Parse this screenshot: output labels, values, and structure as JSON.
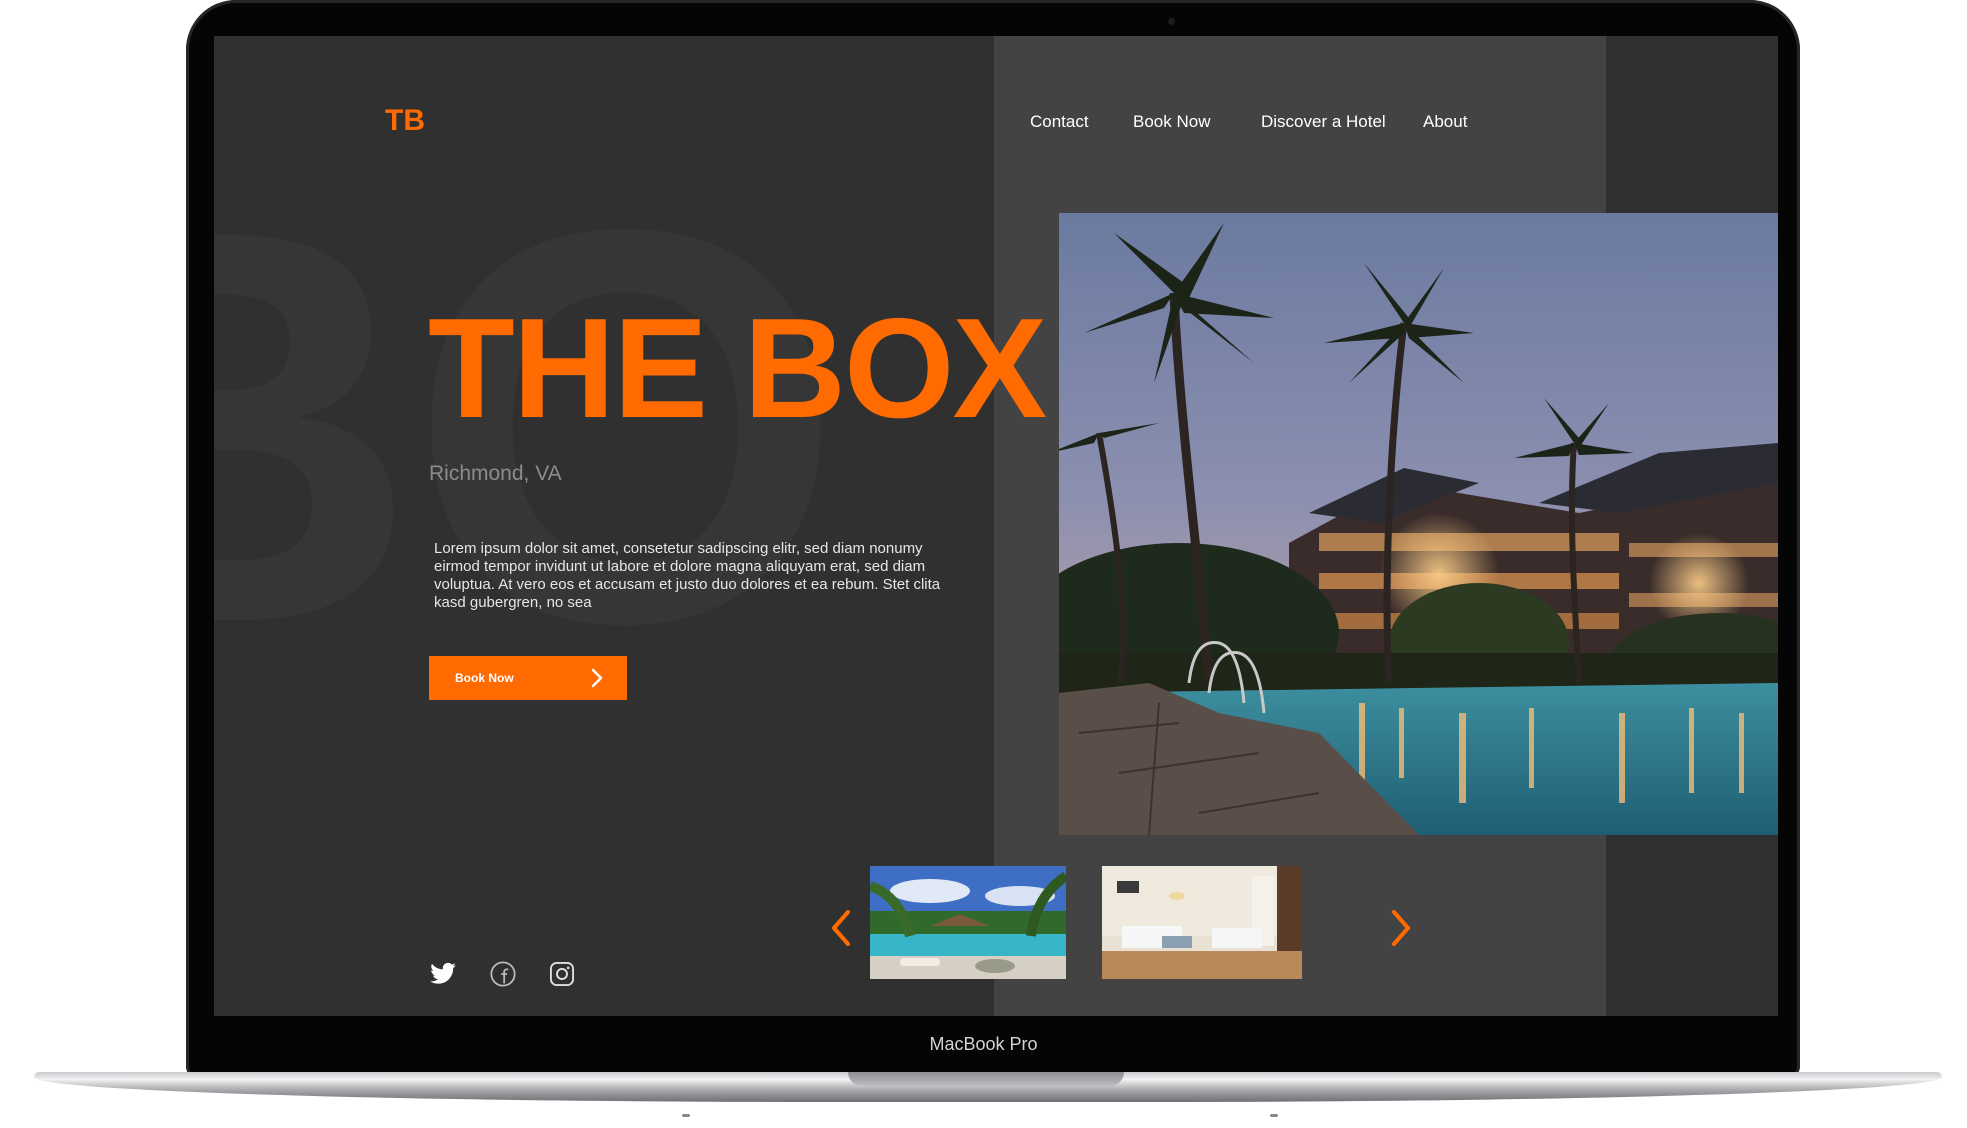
{
  "device": {
    "label": "MacBook Pro"
  },
  "site": {
    "logo": "TB",
    "nav": [
      "Contact",
      "Book Now",
      "Discover a Hotel",
      "About"
    ],
    "hero": {
      "background_letters": "BO",
      "title": "THE BOX",
      "location": "Richmond, VA",
      "description": "Lorem ipsum dolor sit amet, consetetur sadipscing elitr, sed diam nonumy eirmod tempor invidunt ut labore et dolore magna aliquyam erat, sed diam voluptua. At vero eos et accusam et justo duo dolores et ea rebum. Stet clita kasd gubergren, no sea",
      "cta_label": "Book Now"
    },
    "social_icons": [
      "twitter-icon",
      "facebook-icon",
      "instagram-icon"
    ],
    "gallery": {
      "main_image": "resort-pool-at-dusk",
      "thumbnails": [
        "tropical-pool-daytime",
        "hotel-bedroom"
      ],
      "prev_icon": "chevron-left-icon",
      "next_icon": "chevron-right-icon"
    }
  },
  "colors": {
    "accent": "#ff6b00",
    "background": "#303030",
    "panel": "#434343",
    "text": "#ffffff",
    "muted_text": "#8c8c8c"
  }
}
